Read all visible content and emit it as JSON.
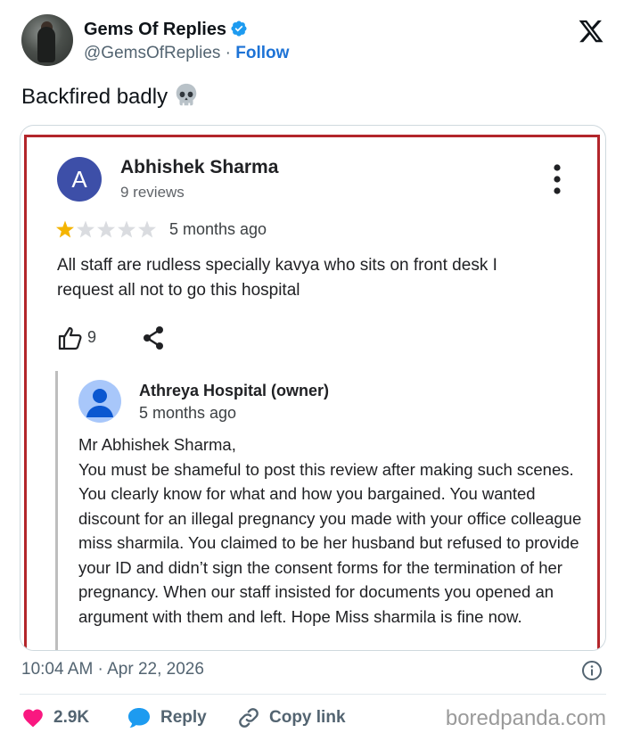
{
  "tweet": {
    "author_name": "Gems Of Replies",
    "handle": "@GemsOfReplies",
    "separator": "·",
    "follow_label": "Follow",
    "text": "Backfired badly",
    "timestamp": "10:04 AM · Apr 22, 2026"
  },
  "review": {
    "avatar_letter": "A",
    "reviewer_name": "Abhishek Sharma",
    "review_count": "9 reviews",
    "rating": 1,
    "rating_max": 5,
    "date": "5 months ago",
    "text": "All staff are rudless specially kavya who sits on front desk I request all not to go this hospital",
    "likes": "9"
  },
  "owner_reply": {
    "name": "Athreya Hospital (owner)",
    "date": "5 months ago",
    "greeting": "Mr Abhishek Sharma,",
    "text": "You must be shameful to post this review after making such scenes. You clearly know for what and how you bargained. You wanted discount for an illegal pregnancy you made with your office colleague miss sharmila. You claimed to be her husband but refused to provide your ID and didn’t sign the consent forms for the termination of her pregnancy. When our staff insisted for documents you opened an argument with them and left. Hope Miss sharmila is fine now."
  },
  "actions": {
    "likes_count": "2.9K",
    "reply_label": "Reply",
    "copy_link_label": "Copy link"
  },
  "watermark": "boredpanda.com",
  "colors": {
    "accent": "#1d73d6",
    "like": "#f91880",
    "reply": "#1d9bf0",
    "frame": "#b3262b",
    "star": "#f4b400"
  },
  "icons": [
    "verified-icon",
    "x-logo-icon",
    "skull-icon",
    "more-icon",
    "star-icon",
    "thumbs-up-icon",
    "share-icon",
    "person-icon",
    "info-icon",
    "heart-icon",
    "speech-bubble-icon",
    "link-icon"
  ]
}
